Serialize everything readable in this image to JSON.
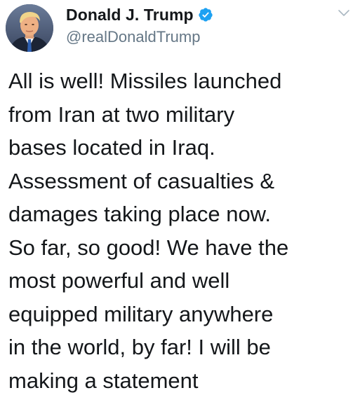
{
  "tweet": {
    "author": {
      "display_name": "Donald J. Trump",
      "handle": "@realDonaldTrump",
      "verified": true,
      "verified_icon": "verified-badge-icon",
      "verified_color": "#1da1f2"
    },
    "menu_icon": "chevron-down-icon",
    "text_lines": [
      "All is well! Missiles launched",
      "from Iran at two military",
      "bases located in Iraq.",
      "Assessment of casualties &",
      "damages taking place now.",
      "So far, so good! We have the",
      "most powerful and well",
      "equipped military anywhere",
      "in the world, by far! I will be",
      "making a statement"
    ]
  }
}
